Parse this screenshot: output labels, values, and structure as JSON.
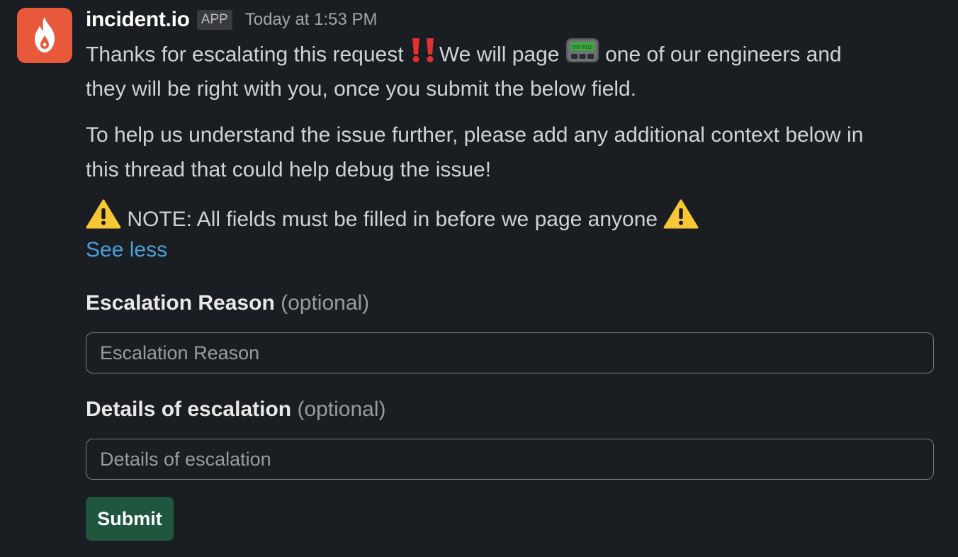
{
  "sender": {
    "name": "incident.io",
    "badge": "APP",
    "timestamp": "Today at 1:53 PM",
    "avatar_icon": "flame-icon",
    "avatar_color": "#e8583b"
  },
  "message": {
    "line1_a": "Thanks for escalating this request ",
    "line1_b": "We will page ",
    "line1_c": " one of our engineers and",
    "line2": "they will be right with you, once you submit the below field.",
    "line3": "To help us understand the issue further, please add any additional context below in",
    "line4": "this thread that could help debug the issue!",
    "note": " NOTE: All fields must be filled in before we page anyone ",
    "see_less": "See less",
    "pager_text": "555-3215"
  },
  "form": {
    "field1": {
      "label": "Escalation Reason",
      "optional": " (optional)",
      "placeholder": "Escalation Reason",
      "value": ""
    },
    "field2": {
      "label": "Details of escalation",
      "optional": " (optional)",
      "placeholder": "Details of escalation",
      "value": ""
    },
    "submit_label": "Submit",
    "submit_color": "#1f573e"
  },
  "colors": {
    "background": "#1a1d21",
    "link": "#4a9fd9",
    "text": "#d1d2d3"
  }
}
